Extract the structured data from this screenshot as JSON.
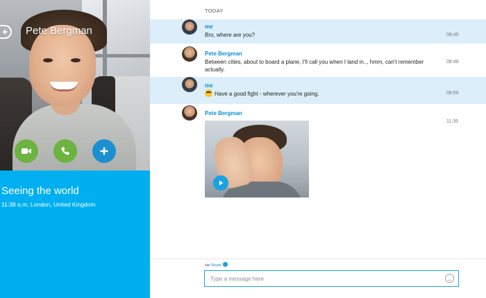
{
  "contact": {
    "name": "Pete Bergman",
    "mood": "Seeing the world",
    "location": "11:38 a.m. London, United Kingdom"
  },
  "conversation": {
    "day_label": "TODAY",
    "messages": [
      {
        "sender": "me",
        "text": "Bro, where are you?",
        "time": "08:45"
      },
      {
        "sender": "Pete Bergman",
        "text": "Between cities, about to board a plane, I'll call you when I land in.., hmm, can't remember actually.",
        "time": "08:48"
      },
      {
        "sender": "me",
        "text": "Have a good fight - wherever you're going.",
        "time": "08:50"
      },
      {
        "sender": "Pete Bergman",
        "text": "",
        "time": "11:35"
      }
    ]
  },
  "composer": {
    "via_prefix": "via",
    "via_service": "Skype",
    "placeholder": "Type a message here"
  },
  "icons": {
    "back": "back-arrow-icon",
    "video_call": "video-camera-icon",
    "voice_call": "phone-icon",
    "add": "plus-icon",
    "play": "play-icon",
    "emoticon": "smiley-icon"
  },
  "colors": {
    "accent": "#00aff0",
    "highlight_row": "#dbeef9",
    "call_green": "#6cb33f",
    "sender_blue": "#0b8ed6",
    "notification_orange": "#f2891e"
  }
}
